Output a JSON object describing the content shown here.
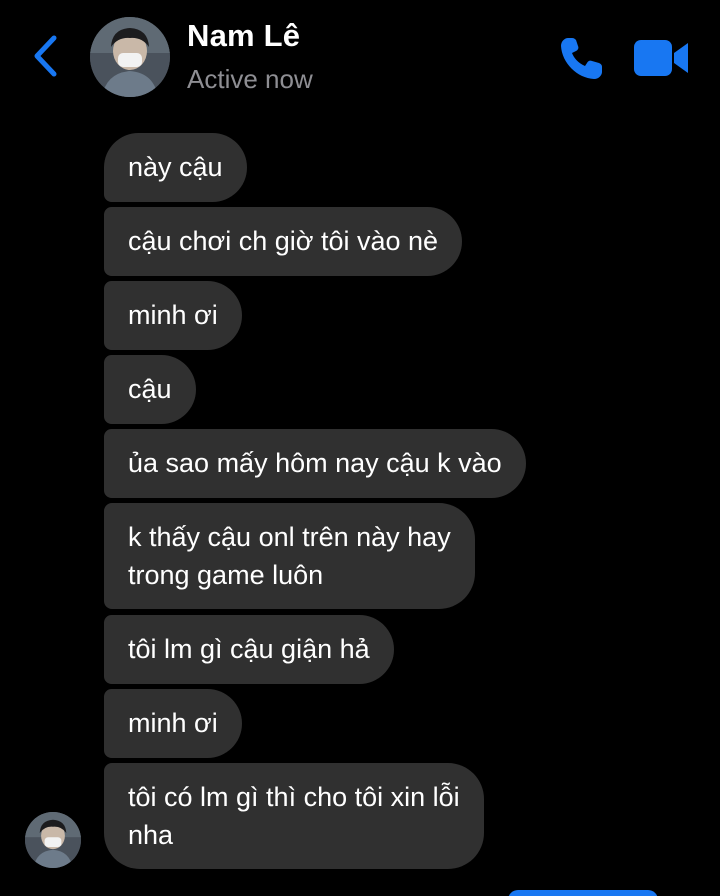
{
  "header": {
    "contact_name": "Nam Lê",
    "status": "Active now",
    "back_icon": "chevron-left-icon",
    "call_icon": "phone-icon",
    "video_icon": "video-camera-icon"
  },
  "colors": {
    "background": "#000000",
    "accent": "#1877f2",
    "bubble_incoming": "#303030",
    "text_primary": "#ffffff",
    "text_secondary": "#8e8e93"
  },
  "messages": [
    {
      "text": "này cậu",
      "direction": "incoming"
    },
    {
      "text": "cậu chơi ch giờ tôi vào nè",
      "direction": "incoming"
    },
    {
      "text": "minh ơi",
      "direction": "incoming"
    },
    {
      "text": "cậu",
      "direction": "incoming"
    },
    {
      "text": "ủa sao mấy hôm nay cậu k vào",
      "direction": "incoming"
    },
    {
      "text": "k thấy cậu onl trên này hay\ntrong game luôn",
      "direction": "incoming"
    },
    {
      "text": "tôi lm gì cậu giận hả",
      "direction": "incoming"
    },
    {
      "text": "minh ơi",
      "direction": "incoming"
    },
    {
      "text": "tôi có lm gì thì cho tôi xin lỗi\nnha",
      "direction": "incoming"
    }
  ]
}
